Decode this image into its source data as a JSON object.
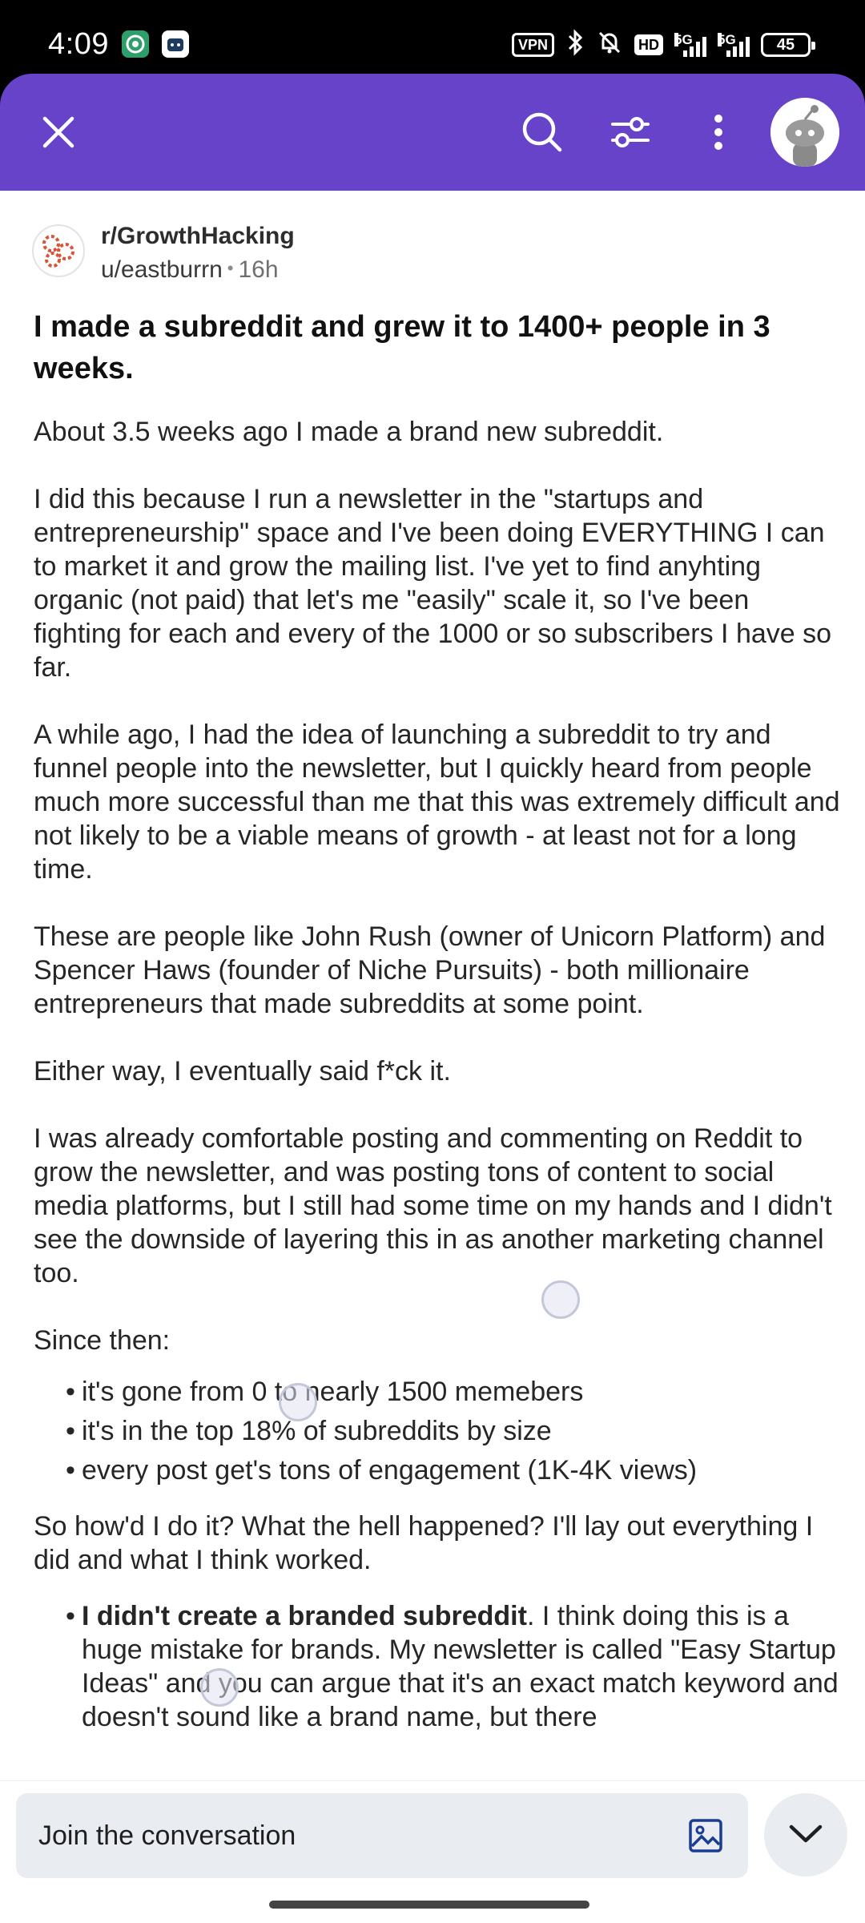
{
  "status_bar": {
    "time": "4:09",
    "vpn": "VPN",
    "hd": "HD",
    "net1": "5G",
    "net2": "5G",
    "battery": "45"
  },
  "header": {
    "close_icon": "close-icon",
    "search_icon": "search-icon",
    "filter_icon": "sort-filter-icon",
    "more_icon": "more-vertical-icon",
    "avatar_icon": "reddit-snoo-avatar",
    "accent_color": "#6743c9"
  },
  "post": {
    "subreddit": "r/GrowthHacking",
    "author": "u/eastburrn",
    "age": "16h",
    "title": "I made a subreddit and grew it to 1400+ people in 3 weeks.",
    "paragraphs": [
      "About 3.5 weeks ago I made a brand new subreddit.",
      "I did this because I run a newsletter in the \"startups and entrepreneurship\" space and I've been doing EVERYTHING I can to market it and grow the mailing list. I've yet to find anyhting organic (not paid) that let's me \"easily\" scale it, so I've been fighting for each and every of the 1000 or so subscribers I have so far.",
      "A while ago, I had the idea of launching a subreddit to try and funnel people into the newsletter, but I quickly heard from people much more successful than me that this was extremely difficult and not likely to be a viable means of growth - at least not for a long time.",
      "These are people like John Rush (owner of Unicorn Platform) and Spencer Haws (founder of Niche Pursuits) - both millionaire entrepreneurs that made subreddits at some point.",
      "Either way, I eventually said f*ck it.",
      "I was already comfortable posting and commenting on Reddit to grow the newsletter, and was posting tons of content to social media platforms, but I still had some time on my hands and I didn't see the downside of layering this in as another marketing channel too."
    ],
    "since_then": "Since then:",
    "results": [
      "it's gone from 0 to nearly 1500 memebers",
      "it's in the top 18% of subreddits by size",
      "every post get's tons of engagement (1K-4K views)"
    ],
    "how_question": "So how'd I do it? What the hell happened? I'll lay out everything I did and what I think worked.",
    "tip_bold": "I didn't create a branded subreddit",
    "tip_text": ". I think doing this is a huge mistake for brands. My newsletter is called \"Easy Startup Ideas\" and you can argue that it's an exact match keyword and doesn't sound like a brand name, but there"
  },
  "bottom_bar": {
    "placeholder": "Join the conversation",
    "image_icon": "add-image-icon",
    "collapse_icon": "chevron-down-icon"
  }
}
